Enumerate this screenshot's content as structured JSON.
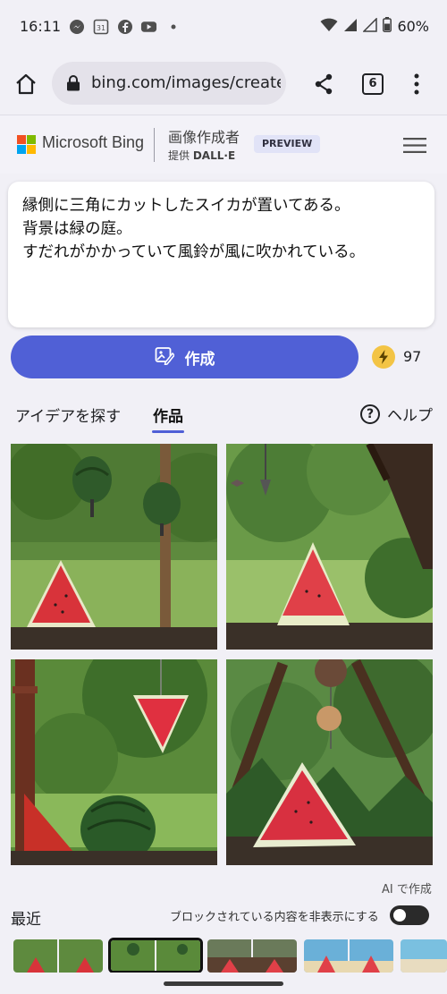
{
  "status_bar": {
    "time": "16:11",
    "notification_icons": [
      "messenger-icon",
      "calendar-icon",
      "facebook-icon",
      "youtube-icon",
      "more-dot-icon"
    ],
    "calendar_day": "31",
    "battery": "60%"
  },
  "browser": {
    "url": "bing.com/images/create",
    "tab_count": "6"
  },
  "header": {
    "brand": "Microsoft Bing",
    "creator_title": "画像作成者",
    "provided_by": "提供",
    "provider_name": "DALL·E",
    "badge": "PREVIEW"
  },
  "prompt": {
    "lines": [
      "縁側に三角にカットしたスイカが置いてある。",
      "背景は緑の庭。",
      "すだれがかかっていて風鈴が風に吹かれている。"
    ]
  },
  "create": {
    "button_label": "作成",
    "boost_count": "97"
  },
  "tabs": {
    "ideas": "アイデアを探す",
    "works": "作品",
    "help": "ヘルプ"
  },
  "results": {
    "ai_label": "AI で作成",
    "images": [
      {
        "name": "watermelon-image-1"
      },
      {
        "name": "watermelon-image-2"
      },
      {
        "name": "watermelon-image-3"
      },
      {
        "name": "watermelon-image-4"
      }
    ]
  },
  "recent": {
    "title": "最近",
    "hide_blocked_label": "ブロックされている内容を非表示にする",
    "hide_blocked_enabled": false
  },
  "colors": {
    "accent": "#5060d6",
    "boost": "#f3c445",
    "background": "#f1f0f6"
  }
}
